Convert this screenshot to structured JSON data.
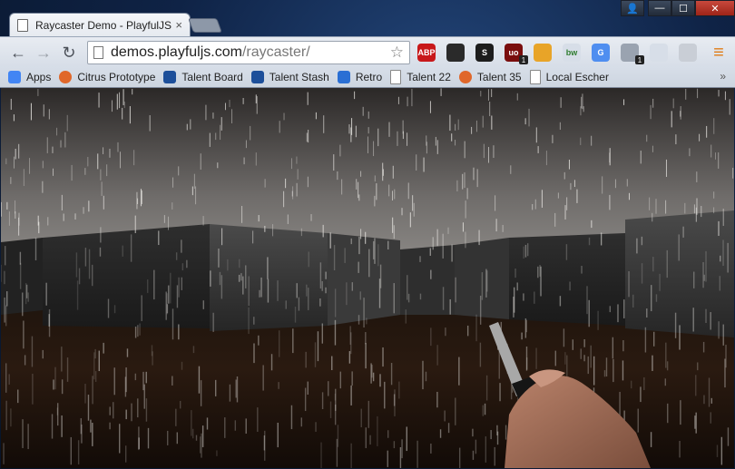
{
  "window": {
    "tab_title": "Raycaster Demo - PlayfulJS",
    "tab_close": "×",
    "controls": {
      "user": "👤",
      "minimize": "—",
      "maximize": "☐",
      "close": "✕"
    }
  },
  "toolbar": {
    "back": "←",
    "forward": "→",
    "reload": "↻",
    "url_host": "demos.playfuljs.com",
    "url_path": "/raycaster/",
    "star": "☆",
    "menu": "≡",
    "extensions": [
      {
        "name": "adblock-plus-icon",
        "label": "ABP",
        "color": "#c8181a"
      },
      {
        "name": "glasses-icon",
        "label": "",
        "color": "#2a2a2a"
      },
      {
        "name": "s-extension-icon",
        "label": "S",
        "color": "#1d1d1d"
      },
      {
        "name": "ublock-icon",
        "label": "uo",
        "color": "#7a0e0e"
      },
      {
        "name": "chrome-ring-icon",
        "label": "",
        "color": "#e8a428"
      },
      {
        "name": "bw-icon",
        "label": "bw",
        "color": "#d7dee8"
      },
      {
        "name": "translate-icon",
        "label": "G",
        "color": "#4f8ef0"
      },
      {
        "name": "ghost-icon",
        "label": "",
        "color": "#9aa3b0"
      },
      {
        "name": "pin-icon",
        "label": "",
        "color": "#d7dee8"
      },
      {
        "name": "megaphone-icon",
        "label": "",
        "color": "#c9ced6"
      }
    ],
    "badge": "1"
  },
  "bookmarks": [
    {
      "label": "Apps",
      "icon": "apps-grid-icon",
      "color": "#4285f4"
    },
    {
      "label": "Citrus Prototype",
      "icon": "citrus-icon",
      "color": "#e0672a"
    },
    {
      "label": "Talent Board",
      "icon": "talent-board-icon",
      "color": "#1d4f9a"
    },
    {
      "label": "Talent Stash",
      "icon": "talent-stash-icon",
      "color": "#1d4f9a"
    },
    {
      "label": "Retro",
      "icon": "retro-icon",
      "color": "#2a6fd4"
    },
    {
      "label": "Talent 22",
      "icon": "page-icon",
      "color": "#ffffff"
    },
    {
      "label": "Talent 35",
      "icon": "citrus-icon",
      "color": "#e0672a"
    },
    {
      "label": "Local Escher",
      "icon": "page-icon",
      "color": "#ffffff"
    }
  ],
  "bookmarks_overflow": "»"
}
